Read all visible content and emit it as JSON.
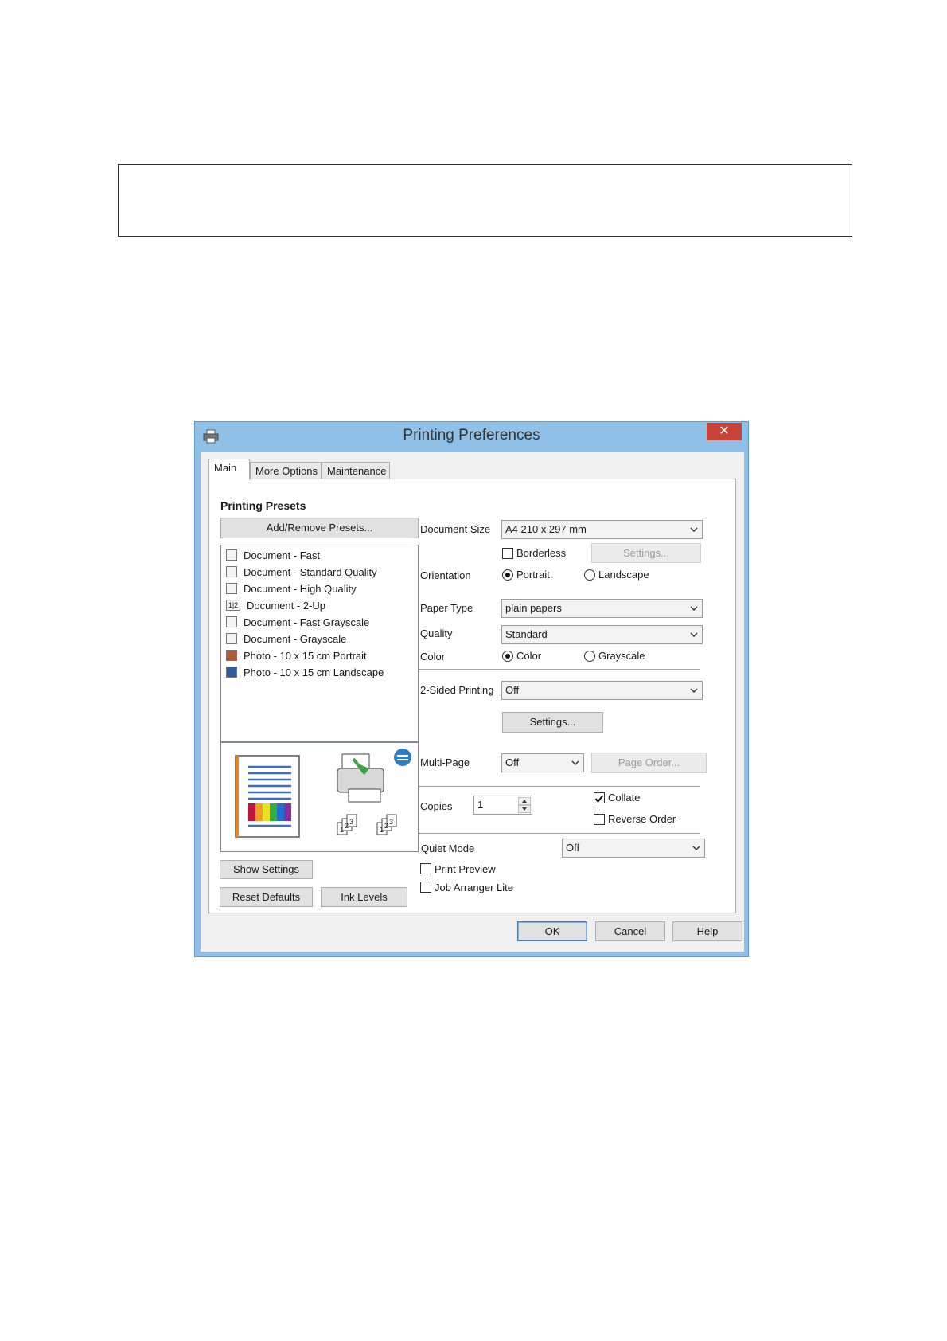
{
  "window": {
    "title": "Printing Preferences",
    "close_label": "✕"
  },
  "tabs": [
    {
      "label": "Main"
    },
    {
      "label": "More Options"
    },
    {
      "label": "Maintenance"
    }
  ],
  "presets": {
    "title": "Printing Presets",
    "add_remove_label": "Add/Remove Presets...",
    "items": [
      {
        "label": "Document - Fast",
        "icon": "document-icon"
      },
      {
        "label": "Document - Standard Quality",
        "icon": "document-icon"
      },
      {
        "label": "Document - High Quality",
        "icon": "document-icon"
      },
      {
        "label": "Document - 2-Up",
        "icon": "two-up-icon",
        "icon_text": "1|2"
      },
      {
        "label": "Document - Fast Grayscale",
        "icon": "document-icon"
      },
      {
        "label": "Document - Grayscale",
        "icon": "document-icon"
      },
      {
        "label": "Photo - 10 x 15 cm Portrait",
        "icon": "photo-portrait-icon"
      },
      {
        "label": "Photo - 10 x 15 cm Landscape",
        "icon": "photo-landscape-icon"
      }
    ]
  },
  "left_buttons": {
    "show_settings": "Show Settings",
    "reset_defaults": "Reset Defaults",
    "ink_levels": "Ink Levels"
  },
  "settings": {
    "document_size": {
      "label": "Document Size",
      "value": "A4 210 x 297 mm"
    },
    "borderless": {
      "label": "Borderless",
      "checked": false,
      "settings_label": "Settings..."
    },
    "orientation": {
      "label": "Orientation",
      "portrait": "Portrait",
      "landscape": "Landscape",
      "selected": "Portrait"
    },
    "paper_type": {
      "label": "Paper Type",
      "value": "plain papers"
    },
    "quality": {
      "label": "Quality",
      "value": "Standard"
    },
    "color": {
      "label": "Color",
      "color": "Color",
      "grayscale": "Grayscale",
      "selected": "Color"
    },
    "two_sided": {
      "label": "2-Sided Printing",
      "value": "Off",
      "settings_label": "Settings..."
    },
    "multi_page": {
      "label": "Multi-Page",
      "value": "Off",
      "page_order_label": "Page Order..."
    },
    "copies": {
      "label": "Copies",
      "value": "1"
    },
    "collate": {
      "label": "Collate",
      "checked": true
    },
    "reverse_order": {
      "label": "Reverse Order",
      "checked": false
    },
    "quiet_mode": {
      "label": "Quiet Mode",
      "value": "Off"
    },
    "print_preview": {
      "label": "Print Preview",
      "checked": false
    },
    "job_arranger": {
      "label": "Job Arranger Lite",
      "checked": false
    }
  },
  "footer": {
    "ok": "OK",
    "cancel": "Cancel",
    "help": "Help"
  },
  "preview": {
    "collate_numbers": [
      "1",
      "2",
      "3"
    ]
  },
  "colors": {
    "titlebar": "#8fc1e8",
    "close": "#c7443a",
    "accent": "#3c7fb1"
  }
}
